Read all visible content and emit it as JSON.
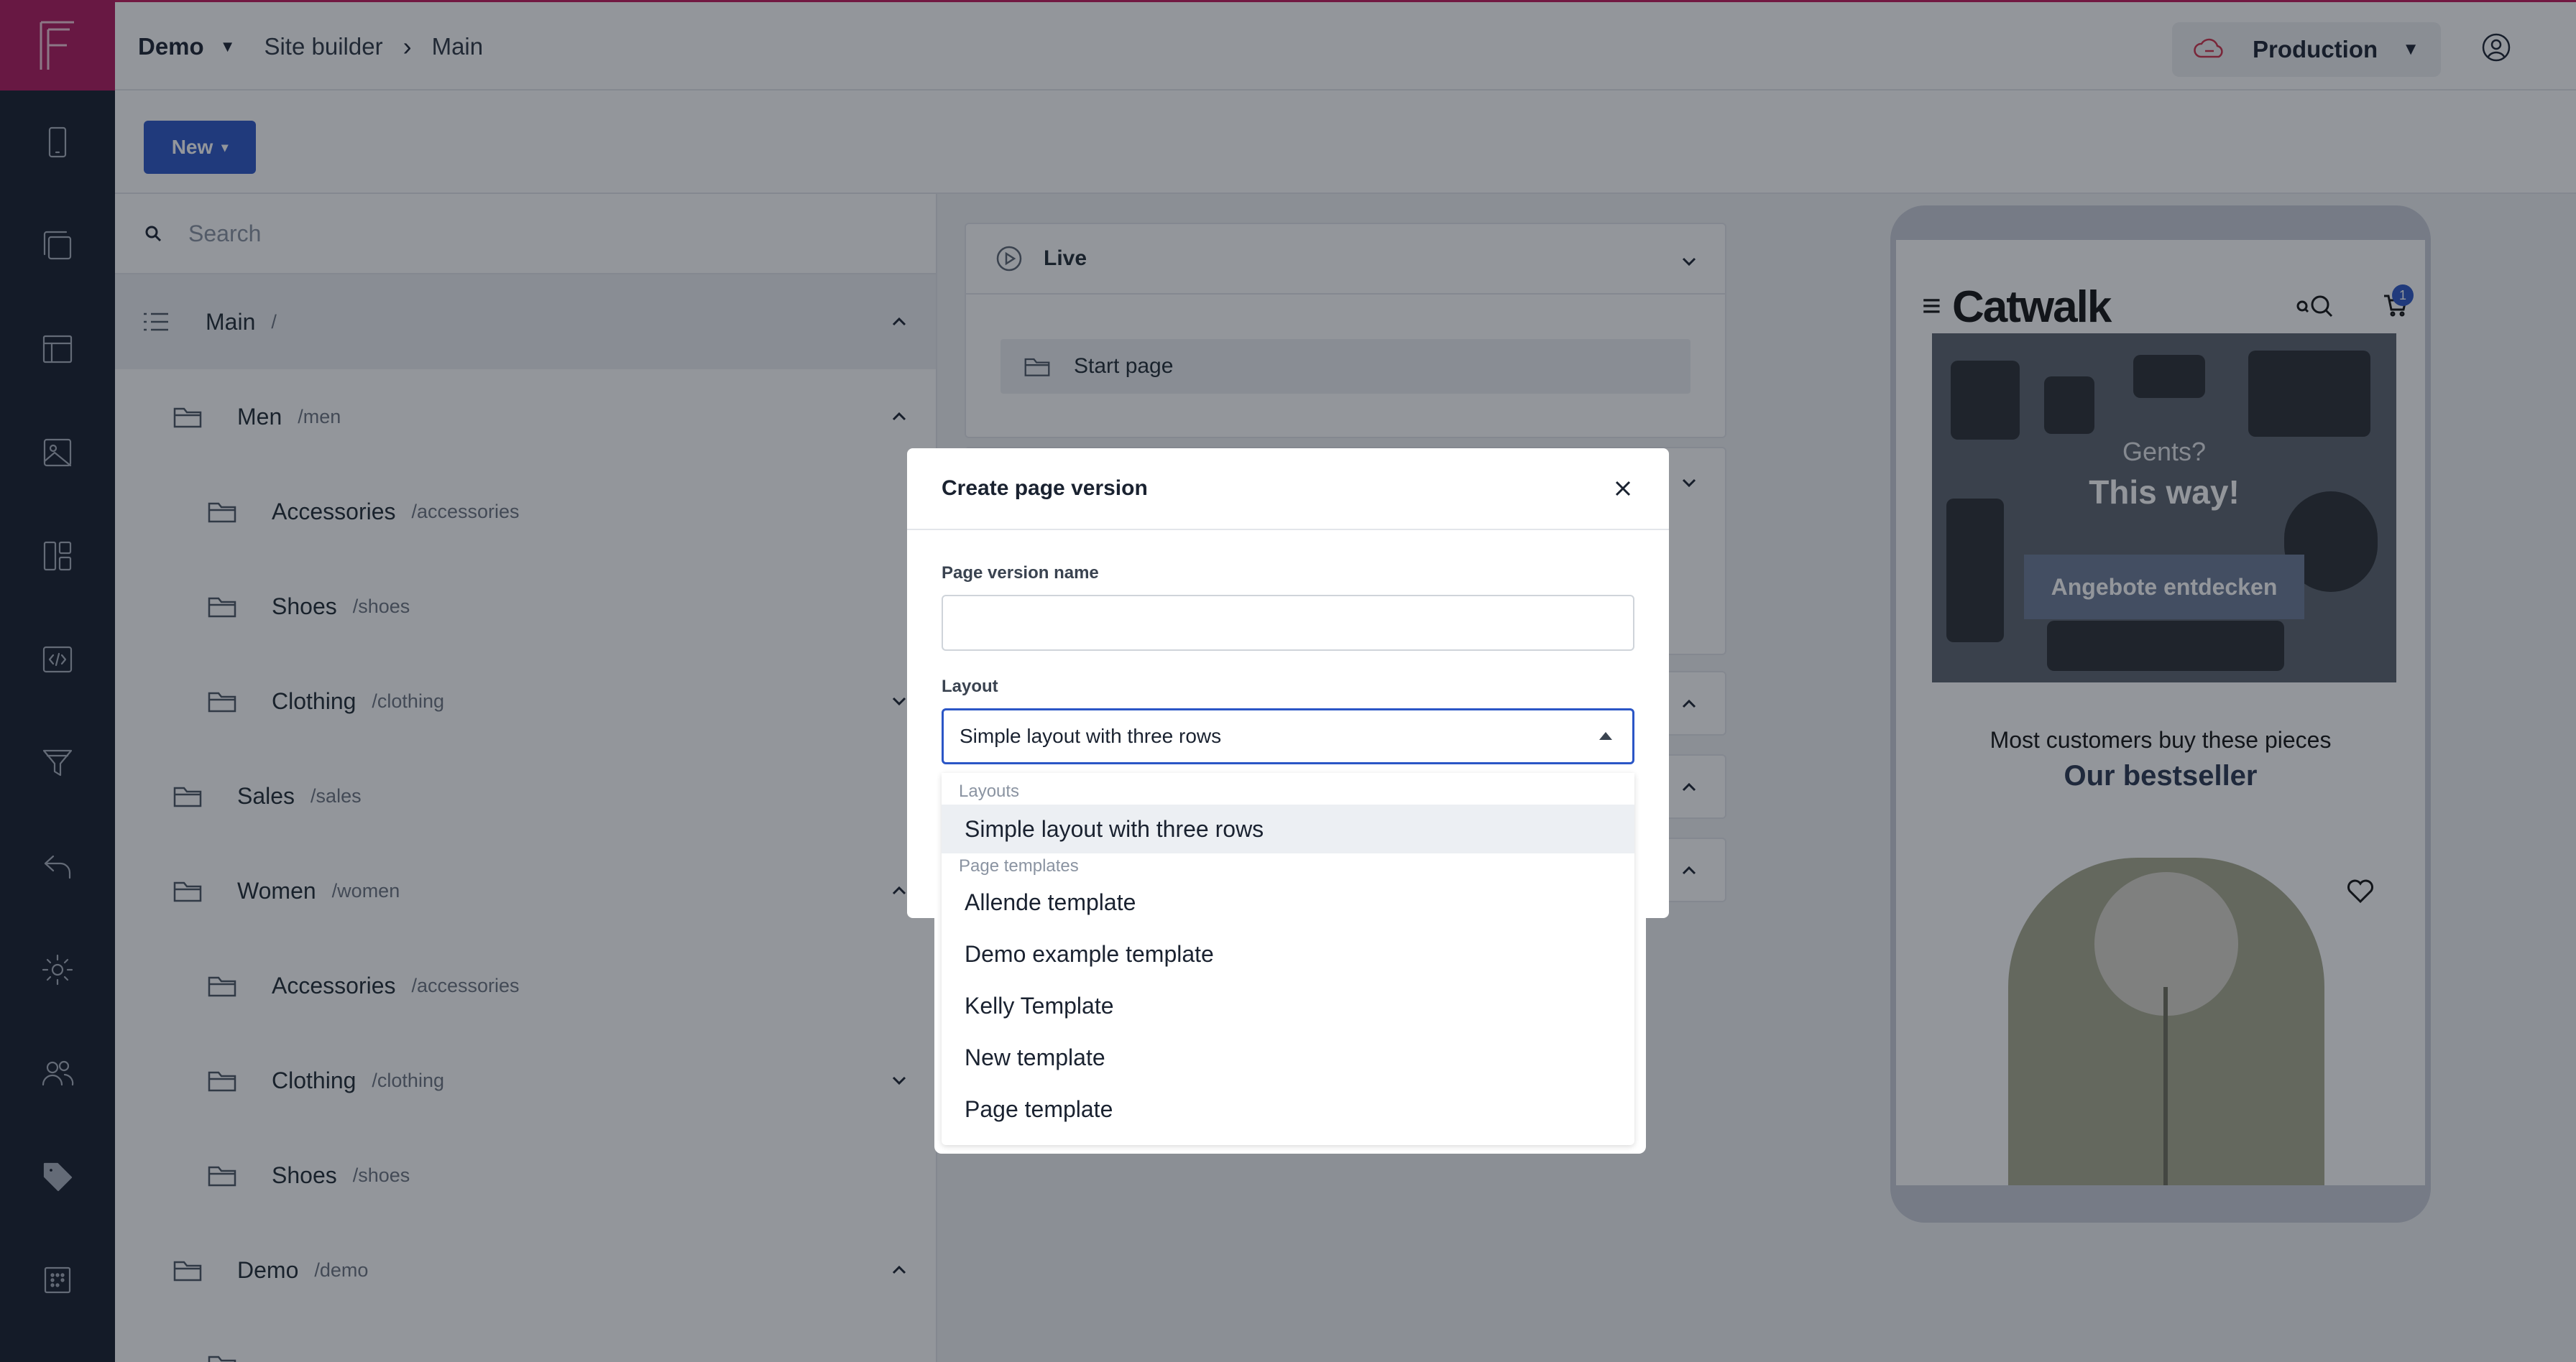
{
  "topbar": {
    "project": "Demo",
    "breadcrumb": [
      "Site builder",
      "Main"
    ],
    "environment": "Production"
  },
  "toolbar": {
    "new_label": "New"
  },
  "tree": {
    "search_placeholder": "Search",
    "rows": [
      {
        "name": "Main",
        "slug": "/"
      },
      {
        "name": "Men",
        "slug": "/men"
      },
      {
        "name": "Accessories",
        "slug": "/accessories"
      },
      {
        "name": "Shoes",
        "slug": "/shoes"
      },
      {
        "name": "Clothing",
        "slug": "/clothing"
      },
      {
        "name": "Sales",
        "slug": "/sales"
      },
      {
        "name": "Women",
        "slug": "/women"
      },
      {
        "name": "Accessories",
        "slug": "/accessories"
      },
      {
        "name": "Clothing",
        "slug": "/clothing"
      },
      {
        "name": "Shoes",
        "slug": "/shoes"
      },
      {
        "name": "Demo",
        "slug": "/demo"
      }
    ]
  },
  "versions": {
    "live_label": "Live",
    "start_page": "Start page"
  },
  "preview": {
    "brand": "Catwalk",
    "cart_count": "1",
    "hero_line1": "Gents?",
    "hero_line2": "This way!",
    "hero_cta": "Angebote entdecken",
    "subtitle": "Most customers buy these pieces",
    "bestseller": "Our bestseller"
  },
  "modal": {
    "title": "Create page version",
    "name_label": "Page version name",
    "name_value": "",
    "layout_label": "Layout",
    "layout_selected": "Simple layout with three rows",
    "groups": {
      "layouts": "Layouts",
      "templates": "Page templates"
    },
    "layout_options": [
      "Simple layout with three rows"
    ],
    "template_options": [
      "Allende template",
      "Demo example template",
      "Kelly Template",
      "New template",
      "Page template"
    ]
  },
  "colors": {
    "rail": "#161d2b",
    "logo": "#b0175d",
    "accent": "#2b56c6"
  }
}
